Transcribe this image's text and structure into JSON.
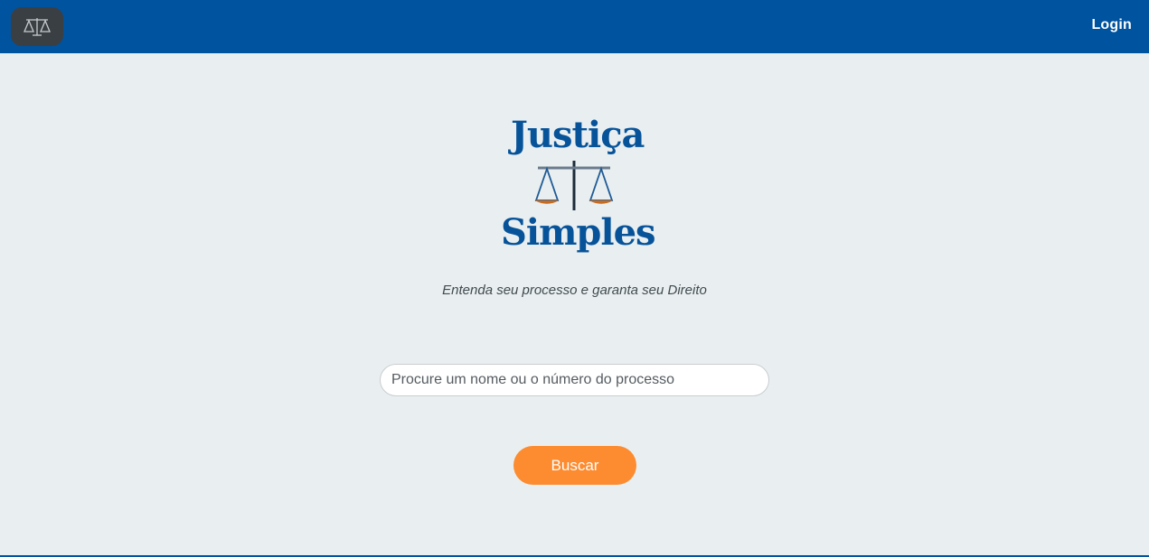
{
  "header": {
    "home_icon": "scales-icon",
    "login_label": "Login"
  },
  "logo": {
    "word_top": "Justiça",
    "word_bottom": "Simples",
    "icon": "scales-of-justice-icon"
  },
  "hero": {
    "tagline": "Entenda seu processo e garanta seu Direito"
  },
  "search": {
    "placeholder": "Procure um nome ou o número do processo",
    "value": ""
  },
  "actions": {
    "search_button_label": "Buscar"
  },
  "colors": {
    "header": "#00539f",
    "background": "#e9eff0",
    "accent": "#fd8b2f",
    "brand_text": "#07539a"
  }
}
